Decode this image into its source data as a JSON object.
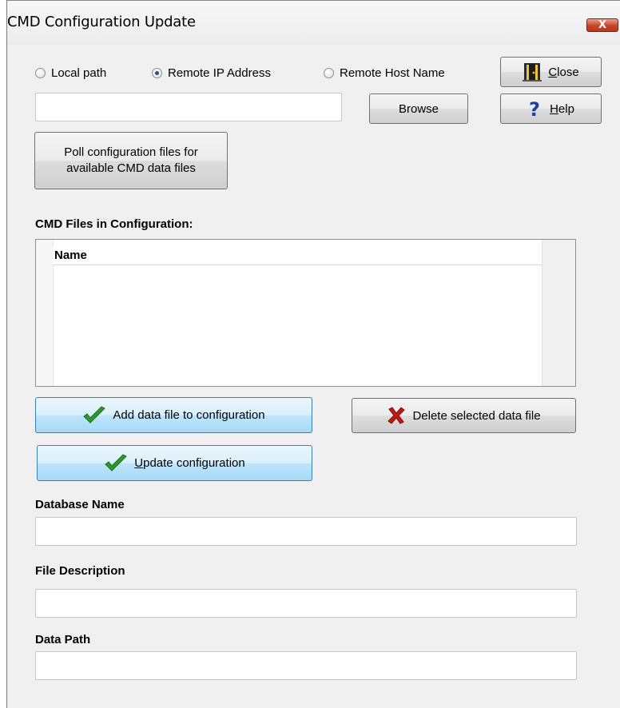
{
  "window": {
    "title": "CMD Configuration Update",
    "close_glyph": "X"
  },
  "source": {
    "options": [
      {
        "label": "Local path",
        "selected": false
      },
      {
        "label": "Remote IP Address",
        "selected": true
      },
      {
        "label": "Remote Host Name",
        "selected": false
      }
    ],
    "path_value": ""
  },
  "buttons": {
    "browse": "Browse",
    "close_prefix": "C",
    "close_rest": "lose",
    "help_prefix": "H",
    "help_rest": "elp",
    "poll_line1": "Poll configuration files for",
    "poll_line2": "available CMD data files",
    "add": "Add data file to configuration",
    "delete": "Delete selected data file",
    "update_prefix": "U",
    "update_rest": "pdate configuration"
  },
  "files": {
    "label": "CMD Files in Configuration:",
    "column_name": "Name",
    "rows": []
  },
  "fields": {
    "database_name_label": "Database Name",
    "database_name_value": "",
    "file_description_label": "File Description",
    "file_description_value": "",
    "data_path_label": "Data Path",
    "data_path_value": ""
  },
  "icons": {
    "close": "door-exit-icon",
    "help": "question-mark-icon",
    "add": "checkmark-icon",
    "delete": "red-x-icon",
    "update": "checkmark-icon"
  },
  "colors": {
    "window_bg": "#f0f0f0",
    "check_green": "#2e9a2e",
    "delete_red": "#c21a12",
    "help_blue": "#1f3fa6"
  }
}
